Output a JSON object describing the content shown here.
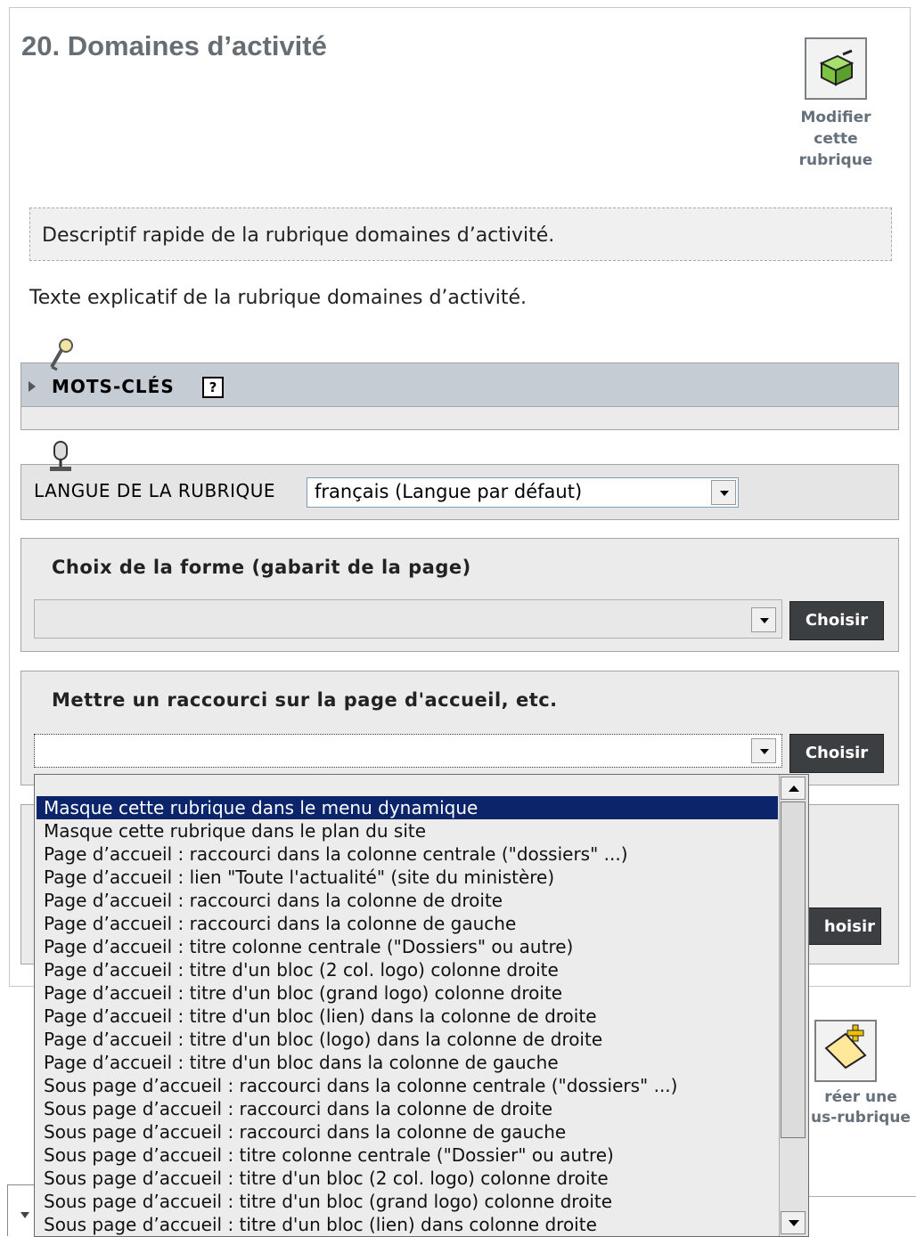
{
  "page": {
    "title": "20. Domaines d’activité",
    "modify_button": {
      "line1": "Modifier",
      "line2": "cette",
      "line3": "rubrique",
      "icon": "box-edit-icon"
    },
    "descriptif": "Descriptif rapide de la rubrique domaines d’activité.",
    "texte": "Texte explicatif de la rubrique domaines d’activité."
  },
  "mots_cles": {
    "label": "MOTS-CLÉS",
    "help": "?",
    "icon": "key-icon"
  },
  "langue": {
    "label": "LANGUE DE LA RUBRIQUE",
    "selected": "français (Langue par défaut)",
    "icon": "microphone-icon"
  },
  "forme": {
    "title": "Choix de la forme (gabarit de la page)",
    "selected": "",
    "button": "Choisir"
  },
  "raccourci": {
    "title": "Mettre un raccourci sur la page d'accueil, etc.",
    "selected": "",
    "button": "Choisir",
    "options": [
      "Masque cette rubrique dans le menu dynamique",
      "Masque cette rubrique dans le plan du site",
      "Page d’accueil : raccourci dans la colonne centrale (\"dossiers\" ...)",
      "Page d’accueil : lien \"Toute l'actualité\" (site du ministère)",
      "Page d’accueil : raccourci dans la colonne de droite",
      "Page d’accueil : raccourci dans la colonne de gauche",
      "Page d’accueil : titre colonne centrale (\"Dossiers\" ou autre)",
      "Page d’accueil : titre d'un bloc (2 col. logo) colonne droite",
      "Page d’accueil : titre d'un bloc (grand logo) colonne droite",
      "Page d’accueil : titre d'un bloc (lien) dans la colonne de droite",
      "Page d’accueil : titre d'un bloc (logo) dans la colonne de droite",
      "Page d’accueil : titre d'un bloc dans la colonne de gauche",
      "Sous page d’accueil : raccourci dans la colonne centrale (\"dossiers\" ...)",
      "Sous page d’accueil : raccourci dans la colonne de droite",
      "Sous page d’accueil : raccourci dans la colonne de gauche",
      "Sous page d’accueil : titre colonne centrale (\"Dossier\" ou autre)",
      "Sous page d’accueil : titre d'un bloc (2 col. logo) colonne droite",
      "Sous page d’accueil : titre d'un bloc (grand logo) colonne droite",
      "Sous page d’accueil : titre d'un bloc (lien) dans colonne droite"
    ]
  },
  "hidden_panel": {
    "button": "hoisir"
  },
  "creer": {
    "line1": "réer une",
    "line2": "us-rubrique",
    "icon": "new-folder-icon"
  }
}
